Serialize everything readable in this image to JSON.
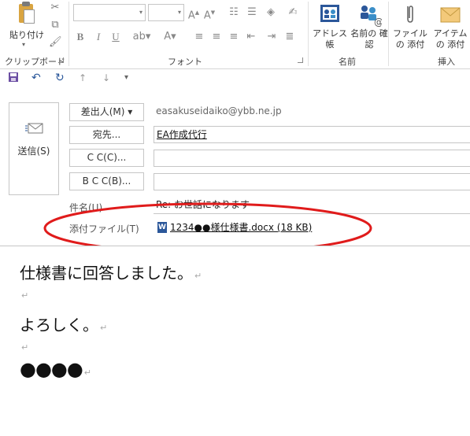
{
  "ribbon": {
    "clipboard": {
      "paste_label": "貼り付け",
      "group_label": "クリップボード"
    },
    "font": {
      "group_label": "フォント"
    },
    "names": {
      "address_book_label": "アドレス帳",
      "check_names_label": "名前の 確認",
      "group_label": "名前"
    },
    "insert": {
      "attach_file_label": "ファイルの 添付",
      "attach_item_label": "アイテムの 添付",
      "group_label": "挿入"
    }
  },
  "compose": {
    "send_label": "送信(S)",
    "from_button": "差出人(M)",
    "from_email": "easakuseidaiko@ybb.ne.jp",
    "to_button": "宛先...",
    "to_value": "EA作成代行",
    "cc_button": "C C(C)...",
    "cc_value": "",
    "bcc_button": "B C C(B)...",
    "bcc_value": "",
    "subject_label": "件名(U)",
    "subject_value": "Re: お世話になります",
    "attachment_label": "添付ファイル(T)",
    "attachment_value": "1234●●様仕様書.docx (18 KB)"
  },
  "body": {
    "line1": "仕様書に回答しました。",
    "line2": "よろしく。",
    "line3": "●●●●",
    "paragraph_mark": "↵"
  },
  "colors": {
    "accent_blue": "#2b579a",
    "annotation_red": "#e01b1b"
  }
}
